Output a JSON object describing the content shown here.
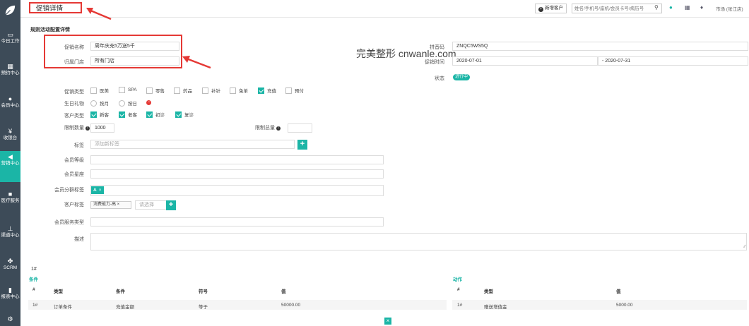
{
  "sidebar": {
    "items": [
      {
        "icon": "monitor-icon",
        "glyph": "▭",
        "label": "今日工作",
        "active": false
      },
      {
        "icon": "calendar-icon",
        "glyph": "▦",
        "label": "预约中心",
        "active": false
      },
      {
        "icon": "users-icon",
        "glyph": "●",
        "label": "会员中心",
        "active": false
      },
      {
        "icon": "yen-icon",
        "glyph": "¥",
        "label": "收银台",
        "active": false
      },
      {
        "icon": "megaphone-icon",
        "glyph": "◀",
        "label": "营销中心",
        "active": true
      },
      {
        "icon": "medkit-icon",
        "glyph": "■",
        "label": "医疗服务",
        "active": false
      },
      {
        "icon": "sitemap-icon",
        "glyph": "⊥",
        "label": "渠道中心",
        "active": false
      },
      {
        "icon": "scrm-icon",
        "glyph": "✤",
        "label": "SCRM",
        "active": false
      },
      {
        "icon": "report-icon",
        "glyph": "▮",
        "label": "报表中心",
        "active": false
      },
      {
        "icon": "gear-icon",
        "glyph": "⚙",
        "label": "",
        "active": false
      }
    ]
  },
  "header": {
    "title": "促销详情",
    "new_customer": "新增客户",
    "search_placeholder": "姓名/手机号/座机/会员卡号/病历号",
    "store": "市场 (张江店)"
  },
  "section": {
    "title": "规则活动配置详情"
  },
  "form": {
    "promo_name_label": "促销名称",
    "promo_name": "周年庆充5万送5千",
    "store_label": "归属门店",
    "store": "所有门店",
    "pinyin_label": "拼音码",
    "pinyin": "ZNQC5WS5Q",
    "time_label": "促销时间",
    "start_date": "2020-07-01",
    "end_date": "2020-07-31",
    "dash": "-",
    "status_label": "状态",
    "status": "进行中",
    "type_label": "促销类型",
    "types": [
      {
        "label": "医美",
        "checked": false
      },
      {
        "label": "SPA",
        "checked": false
      },
      {
        "label": "零售",
        "checked": false
      },
      {
        "label": "药品",
        "checked": false
      },
      {
        "label": "补针",
        "checked": false
      },
      {
        "label": "免单",
        "checked": false
      },
      {
        "label": "充值",
        "checked": true
      },
      {
        "label": "预付",
        "checked": false
      }
    ],
    "birthday_label": "生日礼物",
    "birthday_options": [
      "按月",
      "按日"
    ],
    "customer_type_label": "客户类型",
    "customer_types": [
      {
        "label": "新客",
        "checked": true
      },
      {
        "label": "老客",
        "checked": true
      },
      {
        "label": "初诊",
        "checked": true
      },
      {
        "label": "复诊",
        "checked": true
      }
    ],
    "limit_qty_label": "限制数量",
    "limit_qty": "1000",
    "limit_total_label": "限制总量",
    "tag_label": "标签",
    "tag_placeholder": "添加新标签",
    "member_level_label": "会员等级",
    "member_star_label": "会员星座",
    "member_group_label": "会员分群标签",
    "member_group_tag": "A",
    "customer_tag_label": "客户标签",
    "customer_tag": "消费能力-高",
    "customer_tag_placeholder": "请选择",
    "member_service_label": "会员服务类型",
    "desc_label": "描述"
  },
  "rules": {
    "rule_no": "1#",
    "conditions": {
      "title": "条件",
      "headers": [
        "#",
        "类型",
        "条件",
        "符号",
        "值"
      ],
      "rows": [
        [
          "1#",
          "订单条件",
          "充值金额",
          "等于",
          "50000.00"
        ]
      ]
    },
    "actions": {
      "title": "动作",
      "headers": [
        "#",
        "类型",
        "值"
      ],
      "rows": [
        [
          "1#",
          "赠送增值金",
          "5000.00"
        ]
      ]
    }
  },
  "watermark": "完美整形 cnwanle.com",
  "colors": {
    "accent": "#1bb5a6",
    "sidebar": "#3d4b58",
    "annotation": "#e53935"
  }
}
